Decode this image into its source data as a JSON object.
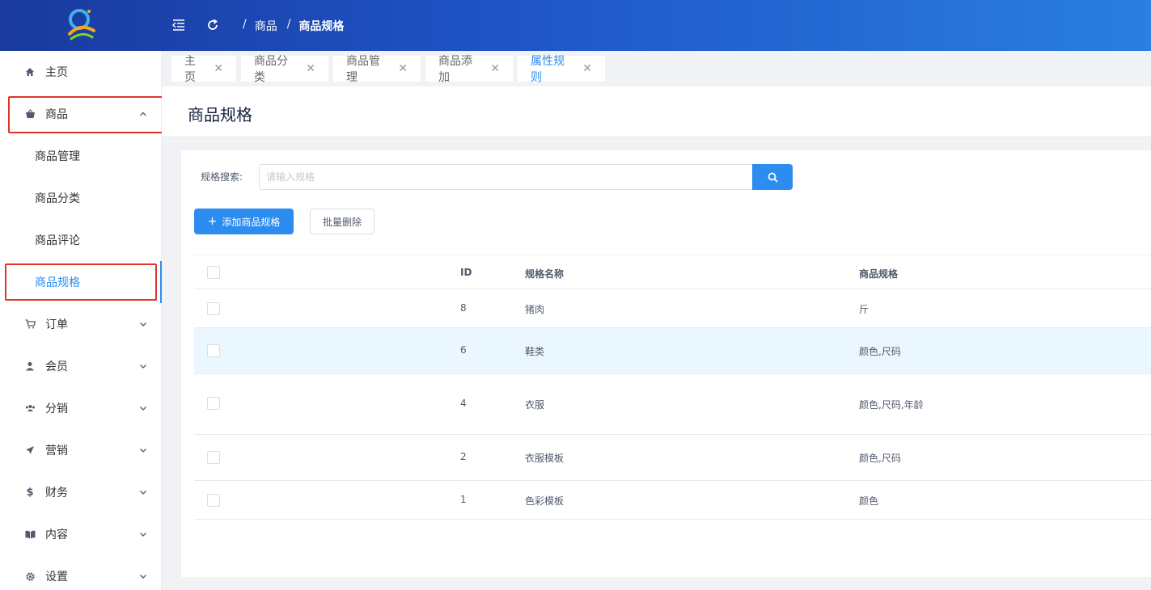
{
  "header": {
    "breadcrumb": [
      {
        "label": "商品"
      },
      {
        "label": "商品规格"
      }
    ]
  },
  "sidebar": {
    "items": [
      {
        "label": "主页",
        "icon": "home-icon"
      },
      {
        "label": "商品",
        "icon": "basket-icon",
        "expanded": true
      },
      {
        "label": "订单",
        "icon": "cart-icon"
      },
      {
        "label": "会员",
        "icon": "user-icon"
      },
      {
        "label": "分销",
        "icon": "group-icon"
      },
      {
        "label": "营销",
        "icon": "send-icon"
      },
      {
        "label": "财务",
        "icon": "dollar-icon"
      },
      {
        "label": "内容",
        "icon": "book-icon"
      },
      {
        "label": "设置",
        "icon": "gear-icon"
      }
    ],
    "sub_items": [
      {
        "label": "商品管理"
      },
      {
        "label": "商品分类"
      },
      {
        "label": "商品评论"
      },
      {
        "label": "商品规格",
        "active": true
      }
    ]
  },
  "tabs": [
    {
      "label": "主页"
    },
    {
      "label": "商品分类"
    },
    {
      "label": "商品管理"
    },
    {
      "label": "商品添加"
    },
    {
      "label": "属性规则",
      "active": true
    }
  ],
  "page": {
    "title": "商品规格",
    "search_label": "规格搜索:",
    "search_placeholder": "请输入规格",
    "add_button": "添加商品规格",
    "batch_delete_button": "批量删除"
  },
  "table": {
    "columns": [
      "ID",
      "规格名称",
      "商品规格"
    ],
    "rows": [
      {
        "id": "8",
        "name": "猪肉",
        "spec": "斤"
      },
      {
        "id": "6",
        "name": "鞋类",
        "spec": "颜色,尺码"
      },
      {
        "id": "4",
        "name": "衣服",
        "spec": "颜色,尺码,年龄"
      },
      {
        "id": "2",
        "name": "衣服模板",
        "spec": "颜色,尺码"
      },
      {
        "id": "1",
        "name": "色彩模板",
        "spec": "颜色"
      }
    ]
  },
  "colors": {
    "primary": "#2d8cf0",
    "header_start": "#1a3a9e",
    "header_end": "#2a7fe0",
    "highlight_row": "#ebf7ff",
    "annotation_red": "#e0342a"
  }
}
